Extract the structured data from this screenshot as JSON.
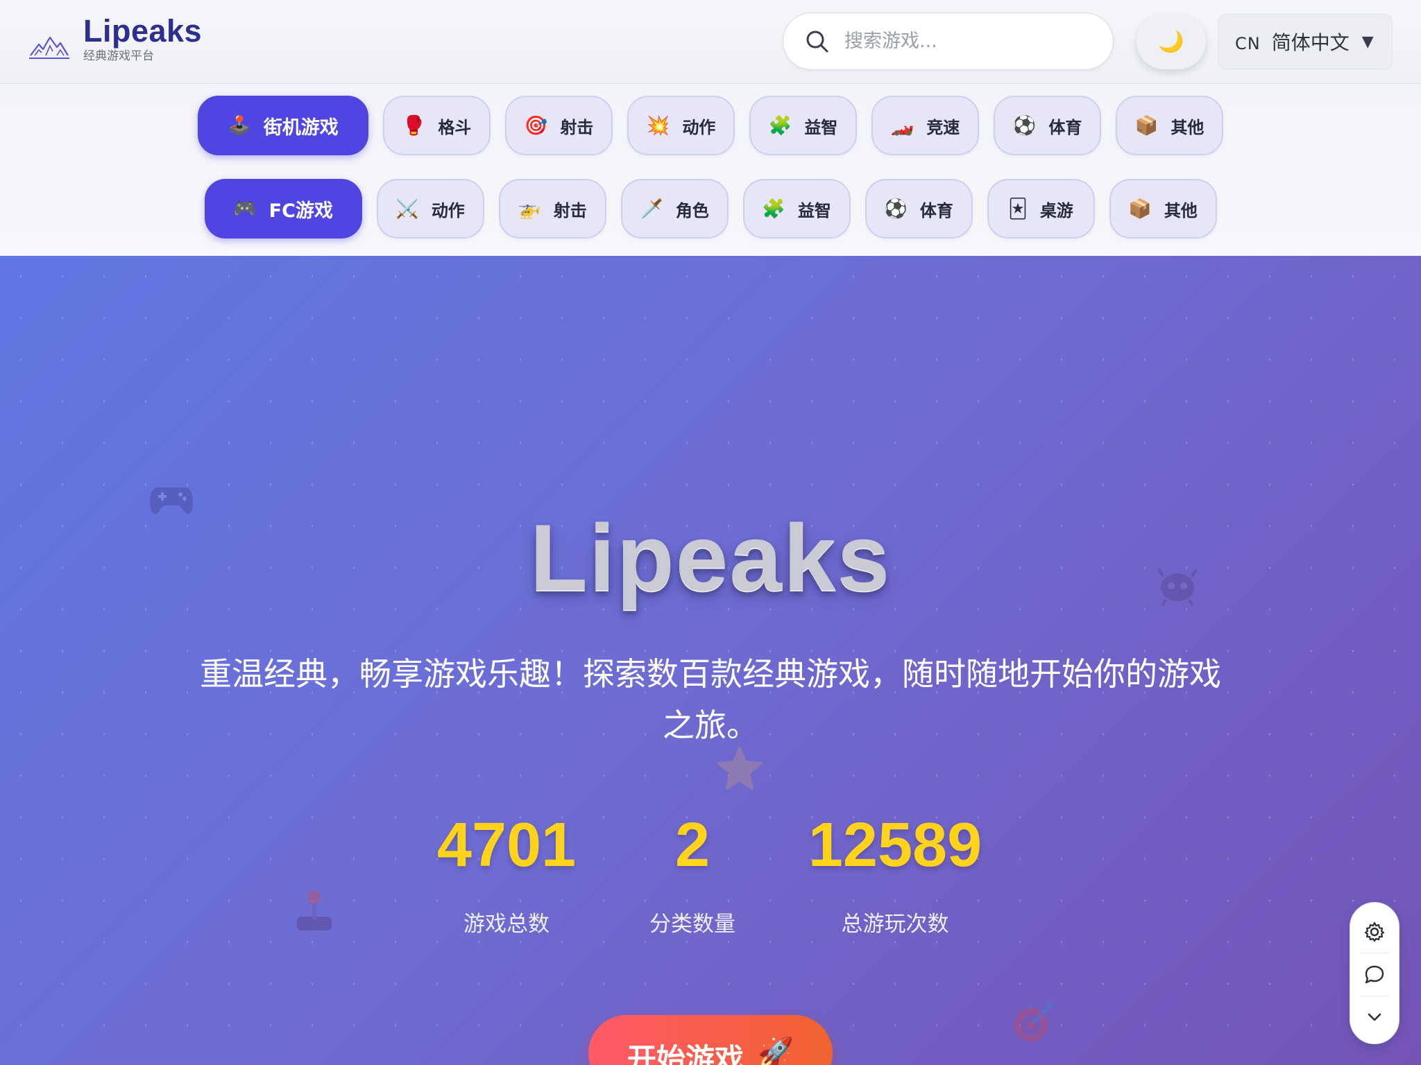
{
  "header": {
    "brand_name": "Lipeaks",
    "brand_tagline": "经典游戏平台",
    "search_placeholder": "搜索游戏...",
    "theme_icon": "moon-icon",
    "lang_code": "CN",
    "lang_label": "简体中文",
    "lang_caret": "▼"
  },
  "nav": {
    "arcade": {
      "label": "街机游戏",
      "icon": "🕹️",
      "items": [
        {
          "label": "格斗",
          "icon": "🥊",
          "name": "boxing-glove-icon"
        },
        {
          "label": "射击",
          "icon": "🎯",
          "name": "target-icon"
        },
        {
          "label": "动作",
          "icon": "💥",
          "name": "explosion-icon"
        },
        {
          "label": "益智",
          "icon": "🧩",
          "name": "puzzle-icon"
        },
        {
          "label": "竞速",
          "icon": "🏎️",
          "name": "race-car-icon"
        },
        {
          "label": "体育",
          "icon": "⚽",
          "name": "soccer-ball-icon"
        },
        {
          "label": "其他",
          "icon": "📦",
          "name": "box-icon"
        }
      ]
    },
    "fc": {
      "label": "FC游戏",
      "icon": "🎮",
      "items": [
        {
          "label": "动作",
          "icon": "⚔️",
          "name": "crossed-swords-icon"
        },
        {
          "label": "射击",
          "icon": "🚁",
          "name": "helicopter-icon"
        },
        {
          "label": "角色",
          "icon": "🗡️",
          "name": "dagger-icon"
        },
        {
          "label": "益智",
          "icon": "🧩",
          "name": "puzzle-icon"
        },
        {
          "label": "体育",
          "icon": "⚽",
          "name": "soccer-ball-icon"
        },
        {
          "label": "桌游",
          "icon": "🃏",
          "name": "playing-card-icon"
        },
        {
          "label": "其他",
          "icon": "📦",
          "name": "box-icon"
        }
      ]
    }
  },
  "hero": {
    "title": "Lipeaks",
    "description": "重温经典，畅享游戏乐趣！探索数百款经典游戏，随时随地开始你的游戏之旅。",
    "stats": [
      {
        "value": "4701",
        "label": "游戏总数"
      },
      {
        "value": "2",
        "label": "分类数量"
      },
      {
        "value": "12589",
        "label": "总游玩次数"
      }
    ],
    "cta_label": "开始游戏",
    "cta_icon": "🚀"
  },
  "side_tools": [
    "gear-icon",
    "chat-bubble-icon",
    "chevron-down-icon"
  ],
  "colors": {
    "accent": "#4f45e0",
    "brand_text": "#2c2f8f",
    "stat_yellow": "#ffd21c",
    "cta_start": "#ff5a68",
    "cta_end": "#f0622f",
    "hero_start": "#6177e2",
    "hero_end": "#7554b6"
  }
}
